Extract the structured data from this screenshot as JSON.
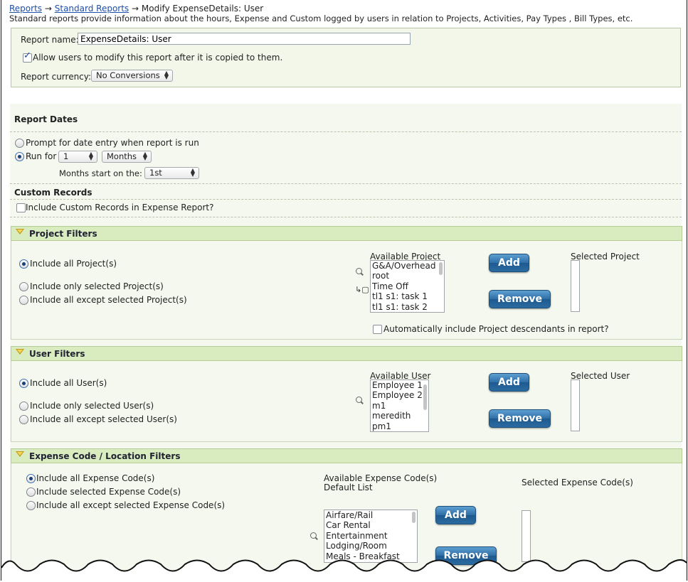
{
  "breadcrumb": {
    "reports": "Reports",
    "arrow": "→",
    "standard_reports": "Standard Reports",
    "current": "Modify ExpenseDetails: User"
  },
  "description": "Standard reports provide information about the hours, Expense and Custom logged by users in relation to Projects, Activities, Pay Types , Bill Types, etc.",
  "report_name": {
    "label": "Report name:",
    "value": "ExpenseDetails: User"
  },
  "allow_modify": {
    "label": "Allow users to modify this report after it is copied to them.",
    "checked": true
  },
  "currency": {
    "label": "Report currency:",
    "value": "No Conversions"
  },
  "report_dates": {
    "heading": "Report Dates",
    "prompt_label": "Prompt for date entry when report is run",
    "run_for_label": "Run for",
    "run_for_count": "1",
    "run_for_unit": "Months",
    "months_start_label": "Months start on the:",
    "months_start_value": "1st"
  },
  "custom_records": {
    "heading": "Custom Records",
    "include_label": "Include Custom Records in Expense Report?"
  },
  "project_filters": {
    "title": "Project Filters",
    "opt_all": "Include all Project(s)",
    "opt_only": "Include only selected Project(s)",
    "opt_except": "Include all except selected Project(s)",
    "available_label": "Available Project",
    "available_items": [
      "G&A/Overhead",
      "root",
      "Time Off",
      "tl1 s1: task 1",
      "tl1 s1: task 2"
    ],
    "selected_label": "Selected Project",
    "add": "Add",
    "remove": "Remove",
    "descendants_label": "Automatically include Project descendants in report?"
  },
  "user_filters": {
    "title": "User Filters",
    "opt_all": "Include all User(s)",
    "opt_only": "Include only selected User(s)",
    "opt_except": "Include all except selected User(s)",
    "available_label": "Available User",
    "available_items": [
      "Employee 1",
      "Employee 2",
      "m1",
      "meredith",
      "pm1"
    ],
    "selected_label": "Selected User",
    "add": "Add",
    "remove": "Remove"
  },
  "expense_filters": {
    "title": "Expense Code / Location Filters",
    "opt_all": "Include all Expense Code(s)",
    "opt_selected": "Include selected Expense Code(s)",
    "opt_except": "Include all except selected Expense Code(s)",
    "available_label": "Available Expense Code(s)",
    "default_list_label": "Default List",
    "available_items": [
      "Airfare/Rail",
      "Car Rental",
      "Entertainment",
      "Lodging/Room",
      "Meals - Breakfast"
    ],
    "selected_label": "Selected Expense Code(s)",
    "add": "Add",
    "remove": "Remove"
  }
}
